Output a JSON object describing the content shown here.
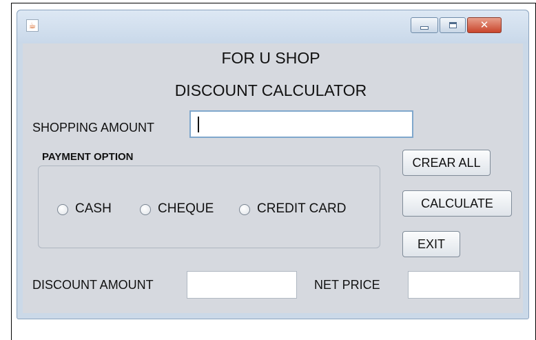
{
  "window": {
    "app_icon": "java-cup-icon",
    "controls": {
      "minimize_icon": "minimize-icon",
      "maximize_icon": "maximize-icon",
      "close_icon": "close-icon"
    }
  },
  "header": {
    "shop_name": "FOR U SHOP",
    "subtitle": "DISCOUNT CALCULATOR"
  },
  "shopping_amount": {
    "label": "SHOPPING AMOUNT",
    "value": ""
  },
  "payment": {
    "group_label": "PAYMENT OPTION",
    "options": [
      {
        "label": "CASH",
        "selected": false
      },
      {
        "label": "CHEQUE",
        "selected": false
      },
      {
        "label": "CREDIT CARD",
        "selected": false
      }
    ]
  },
  "buttons": {
    "clear_all": "CREAR ALL",
    "calculate": "CALCULATE",
    "exit": "EXIT"
  },
  "results": {
    "discount_label": "DISCOUNT AMOUNT",
    "discount_value": "",
    "net_price_label": "NET PRICE",
    "net_price_value": ""
  },
  "colors": {
    "window_border": "#8ba4bf",
    "content_bg": "#d6d9df",
    "focus_border": "#7fa7cc",
    "close_button": "#c9452c"
  }
}
